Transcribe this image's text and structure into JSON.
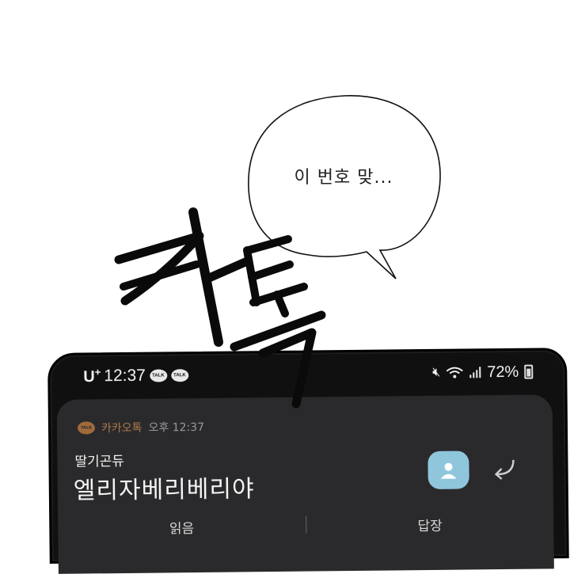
{
  "bubble": {
    "text": "이 번호 맞..."
  },
  "sound_effect": {
    "text": "카톡"
  },
  "status_bar": {
    "carrier": "U",
    "carrier_sup": "+",
    "time": "12:37",
    "battery": "72%",
    "talk_badge": "TALK"
  },
  "notification": {
    "app_badge": "TALK",
    "app_name": "카카오톡",
    "time": "오후 12:37",
    "sender": "딸기곤듀",
    "message": "엘리자베리베리야",
    "action_left": "읽음",
    "action_right": "답장"
  },
  "colors": {
    "phone_body": "#101010",
    "card_bg": "#2a2a2c",
    "avatar_bg": "#8fc6dc",
    "kakao_brand": "#a06a3a"
  }
}
